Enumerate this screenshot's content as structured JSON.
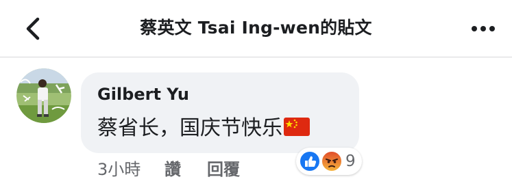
{
  "header": {
    "title": "蔡英文 Tsai Ing-wen的貼文",
    "back_icon": "chevron-left-icon",
    "more_icon": "more-horizontal-icon"
  },
  "comment": {
    "author": "Gilbert Yu",
    "text": "蔡省长，国庆节快乐",
    "emoji": "flag-china-icon",
    "time": "3小時",
    "like_label": "讚",
    "reply_label": "回覆",
    "reactions": {
      "types": [
        "like-icon",
        "angry-icon"
      ],
      "count": "9"
    }
  },
  "colors": {
    "bubble": "#f0f2f5",
    "text": "#1c1e21",
    "secondary_text": "#65676b",
    "like_blue": "#1877f2",
    "angry_orange": "#e9710f",
    "divider": "#d6d7da"
  }
}
